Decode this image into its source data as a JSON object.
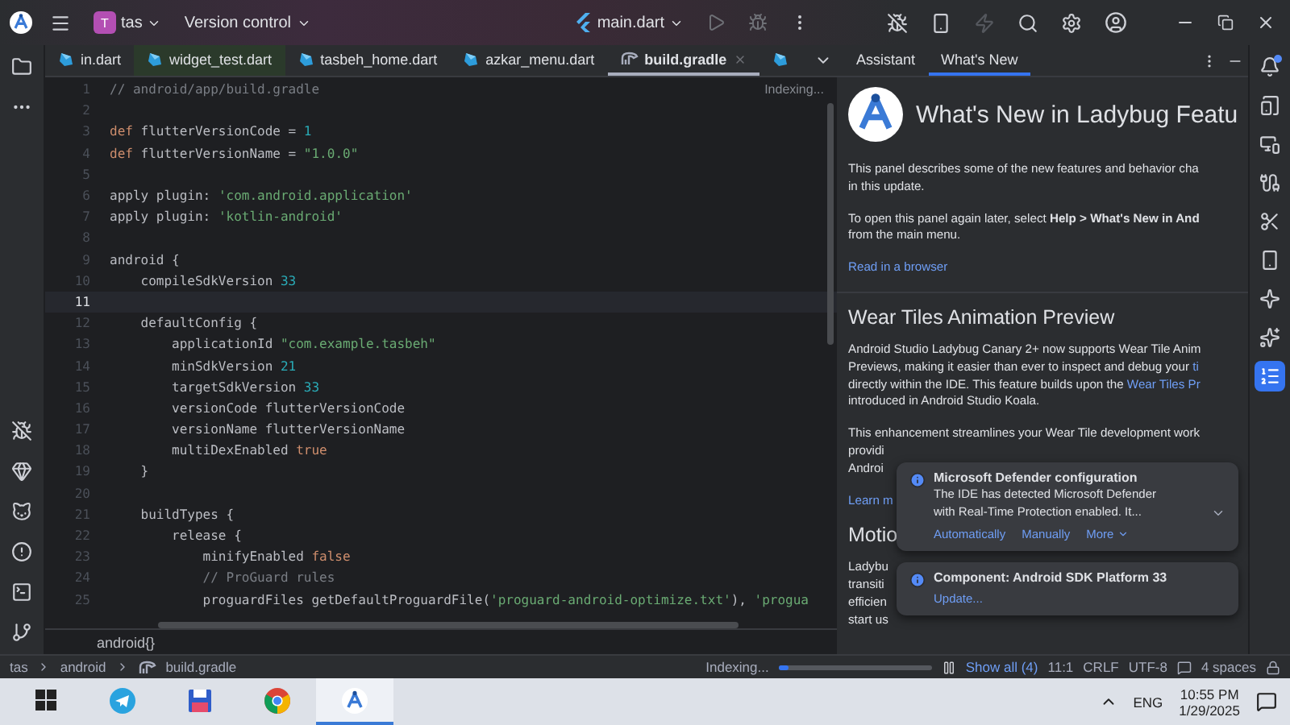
{
  "title_bar": {
    "project_badge": "T",
    "project": "tas",
    "vcs": "Version control",
    "run_config": "main.dart"
  },
  "editor_tabs": [
    {
      "label": "in.dart",
      "kind": "dart",
      "selected": false
    },
    {
      "label": "widget_test.dart",
      "kind": "test",
      "selected": false
    },
    {
      "label": "tasbeh_home.dart",
      "kind": "dart",
      "selected": false
    },
    {
      "label": "azkar_menu.dart",
      "kind": "dart",
      "selected": false
    },
    {
      "label": "build.gradle",
      "kind": "gradle",
      "selected": true
    },
    {
      "kind": "dart",
      "selected": false
    }
  ],
  "editor": {
    "status": "Indexing...",
    "breadcrumb": "android{}",
    "lines": [
      {
        "number": "1",
        "current": false,
        "tokens": [
          {
            "kind": "comment",
            "text": "// android/app/build.gradle"
          }
        ]
      },
      {
        "number": "2",
        "current": false
      },
      {
        "number": "3",
        "current": false,
        "tokens": [
          {
            "kind": "kw",
            "text": "def"
          },
          {
            "kind": "plain",
            "text": " flutterVersionCode = "
          },
          {
            "kind": "num",
            "text": "1"
          }
        ]
      },
      {
        "number": "4",
        "current": false,
        "tokens": [
          {
            "kind": "kw",
            "text": "def"
          },
          {
            "kind": "plain",
            "text": " flutterVersionName = "
          },
          {
            "kind": "str",
            "text": "\"1.0.0\""
          }
        ]
      },
      {
        "number": "5",
        "current": false
      },
      {
        "number": "6",
        "current": false,
        "tokens": [
          {
            "kind": "plain",
            "text": "apply plugin: "
          },
          {
            "kind": "str",
            "text": "'com.android.application'"
          }
        ]
      },
      {
        "number": "7",
        "current": false,
        "tokens": [
          {
            "kind": "plain",
            "text": "apply plugin: "
          },
          {
            "kind": "str",
            "text": "'kotlin-android'"
          }
        ]
      },
      {
        "number": "8",
        "current": false
      },
      {
        "number": "9",
        "current": false,
        "tokens": [
          {
            "kind": "plain",
            "text": "android {"
          }
        ]
      },
      {
        "number": "10",
        "current": false,
        "tokens": [
          {
            "kind": "plain",
            "text": "    compileSdkVersion "
          },
          {
            "kind": "num",
            "text": "33"
          }
        ]
      },
      {
        "number": "11",
        "current": true
      },
      {
        "number": "12",
        "current": false,
        "tokens": [
          {
            "kind": "plain",
            "text": "    defaultConfig {"
          }
        ]
      },
      {
        "number": "13",
        "current": false,
        "tokens": [
          {
            "kind": "plain",
            "text": "        applicationId "
          },
          {
            "kind": "str",
            "text": "\"com.example.tasbeh\""
          }
        ]
      },
      {
        "number": "14",
        "current": false,
        "tokens": [
          {
            "kind": "plain",
            "text": "        minSdkVersion "
          },
          {
            "kind": "num",
            "text": "21"
          }
        ]
      },
      {
        "number": "15",
        "current": false,
        "tokens": [
          {
            "kind": "plain",
            "text": "        targetSdkVersion "
          },
          {
            "kind": "num",
            "text": "33"
          }
        ]
      },
      {
        "number": "16",
        "current": false,
        "tokens": [
          {
            "kind": "plain",
            "text": "        versionCode flutterVersionCode"
          }
        ]
      },
      {
        "number": "17",
        "current": false,
        "tokens": [
          {
            "kind": "plain",
            "text": "        versionName flutterVersionName"
          }
        ]
      },
      {
        "number": "18",
        "current": false,
        "tokens": [
          {
            "kind": "plain",
            "text": "        multiDexEnabled "
          },
          {
            "kind": "kw",
            "text": "true"
          }
        ]
      },
      {
        "number": "19",
        "current": false,
        "tokens": [
          {
            "kind": "plain",
            "text": "    }"
          }
        ]
      },
      {
        "number": "20",
        "current": false
      },
      {
        "number": "21",
        "current": false,
        "tokens": [
          {
            "kind": "plain",
            "text": "    buildTypes {"
          }
        ]
      },
      {
        "number": "22",
        "current": false,
        "tokens": [
          {
            "kind": "plain",
            "text": "        release {"
          }
        ]
      },
      {
        "number": "23",
        "current": false,
        "tokens": [
          {
            "kind": "plain",
            "text": "            minifyEnabled "
          },
          {
            "kind": "kw",
            "text": "false"
          }
        ]
      },
      {
        "number": "24",
        "current": false,
        "tokens": [
          {
            "kind": "comment",
            "text": "            // ProGuard rules"
          }
        ]
      },
      {
        "number": "25",
        "current": false,
        "tokens": [
          {
            "kind": "plain",
            "text": "            proguardFiles getDefaultProguardFile("
          },
          {
            "kind": "str",
            "text": "'proguard-android-optimize.txt'"
          },
          {
            "kind": "plain",
            "text": "), "
          },
          {
            "kind": "str",
            "text": "'progua"
          }
        ]
      }
    ]
  },
  "assistant": {
    "tabs": [
      {
        "label": "Assistant",
        "selected": false
      },
      {
        "label": "What's New",
        "selected": true
      }
    ],
    "title": "What's New in Ladybug Featu",
    "blocks": [
      {
        "kind": "para",
        "lines": [
          [
            {
              "text": "This panel describes some of the new features and behavior cha",
              "link": false
            }
          ],
          [
            {
              "text": "in this update.",
              "link": false
            }
          ]
        ]
      },
      {
        "kind": "para",
        "lines": [
          [
            {
              "text": "To open this panel again later, select **Help > What's New in And**",
              "link": false
            }
          ],
          [
            {
              "text": "from the main menu.",
              "link": false
            }
          ]
        ]
      },
      {
        "kind": "para",
        "lines": [
          [
            {
              "text": "Read in a browser",
              "link": true
            }
          ]
        ]
      },
      {
        "kind": "rule"
      },
      {
        "kind": "heading",
        "lines": [
          [
            {
              "text": "Wear Tiles Animation Preview",
              "link": false
            }
          ]
        ]
      },
      {
        "kind": "para",
        "lines": [
          [
            {
              "text": "Android Studio Ladybug Canary 2+ now supports Wear Tile Anim",
              "link": false
            }
          ],
          [
            {
              "text": "Previews, making it easier than ever to inspect and debug your ",
              "link": false
            },
            {
              "text": "ti",
              "link": true
            }
          ],
          [
            {
              "text": "directly within the IDE. This feature builds upon the ",
              "link": false
            },
            {
              "text": "Wear Tiles Pr",
              "link": true
            }
          ],
          [
            {
              "text": "introduced in Android Studio Koala.",
              "link": false
            }
          ]
        ]
      },
      {
        "kind": "para",
        "lines": [
          [
            {
              "text": "This enhancement streamlines your Wear Tile development work",
              "link": false
            }
          ],
          [
            {
              "text": "providi",
              "link": false
            }
          ],
          [
            {
              "text": "Androi",
              "link": false
            }
          ]
        ]
      },
      {
        "kind": "para",
        "lines": [
          [
            {
              "text": "Learn m",
              "link": true
            }
          ]
        ]
      },
      {
        "kind": "heading",
        "lines": [
          [
            {
              "text": "Motio",
              "link": false
            }
          ]
        ]
      },
      {
        "kind": "para",
        "lines": [
          [
            {
              "text": "Ladybu",
              "link": false
            }
          ],
          [
            {
              "text": "transiti",
              "link": false
            }
          ],
          [
            {
              "text": "efficien",
              "link": false
            }
          ],
          [
            {
              "text": "start us",
              "link": false
            }
          ]
        ]
      }
    ],
    "notifications": [
      {
        "title": "Microsoft Defender configuration",
        "body": [
          "The IDE has detected Microsoft Defender",
          "with Real-Time Protection enabled. It..."
        ],
        "actions": [
          "Automatically",
          "Manually",
          "More"
        ],
        "expandable": true
      },
      {
        "title": "Component: Android SDK Platform 33",
        "actions": [
          "Update..."
        ],
        "expandable": false
      }
    ]
  },
  "status_bar": {
    "path": [
      "tas",
      "android",
      "build.gradle"
    ],
    "indexing": "Indexing...",
    "level": 0.06,
    "show_all": "Show all (4)",
    "caret": "11:1",
    "line_separator": "CRLF",
    "encoding": "UTF-8",
    "indent": "4 spaces"
  },
  "taskbar": {
    "apps": [
      {
        "kind": "telegram",
        "selected": false
      },
      {
        "kind": "floppy",
        "selected": false
      },
      {
        "kind": "chrome",
        "selected": false
      },
      {
        "kind": "studio",
        "selected": true
      }
    ],
    "language": "ENG",
    "time": "10:55 PM",
    "date": "1/29/2025"
  }
}
